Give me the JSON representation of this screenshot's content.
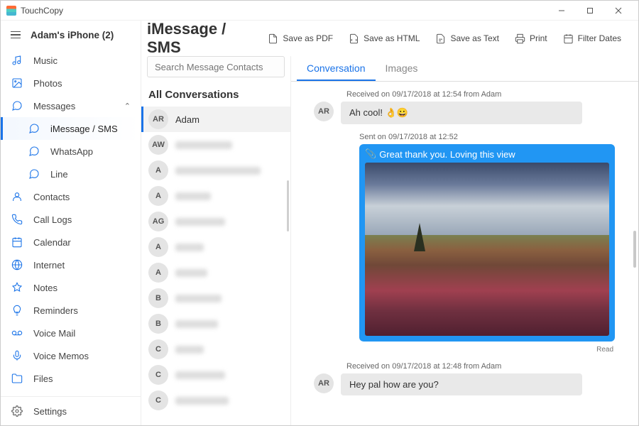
{
  "app": {
    "title": "TouchCopy"
  },
  "device": {
    "name": "Adam's iPhone (2)"
  },
  "nav": {
    "music": "Music",
    "photos": "Photos",
    "messages": "Messages",
    "imessage": "iMessage / SMS",
    "whatsapp": "WhatsApp",
    "line": "Line",
    "contacts": "Contacts",
    "calllogs": "Call Logs",
    "calendar": "Calendar",
    "internet": "Internet",
    "notes": "Notes",
    "reminders": "Reminders",
    "voicemail": "Voice Mail",
    "voicememos": "Voice Memos",
    "files": "Files",
    "settings": "Settings"
  },
  "page": {
    "title": "iMessage / SMS",
    "toolbar": {
      "pdf": "Save as PDF",
      "html": "Save as HTML",
      "text": "Save as Text",
      "print": "Print",
      "filter": "Filter Dates"
    },
    "search_placeholder": "Search Message Contacts",
    "all_conversations": "All Conversations",
    "tabs": {
      "conversation": "Conversation",
      "images": "Images"
    }
  },
  "contacts": [
    {
      "initials": "AR",
      "name": "Adam"
    },
    {
      "initials": "AW"
    },
    {
      "initials": "A"
    },
    {
      "initials": "A"
    },
    {
      "initials": "AG"
    },
    {
      "initials": "A"
    },
    {
      "initials": "A"
    },
    {
      "initials": "B"
    },
    {
      "initials": "B"
    },
    {
      "initials": "C"
    },
    {
      "initials": "C"
    },
    {
      "initials": "C"
    }
  ],
  "conversation": {
    "m1": {
      "meta": "Received on 09/17/2018 at 12:54 from Adam",
      "avatar": "AR",
      "text": "Ah cool! 👌😀"
    },
    "m2": {
      "meta": "Sent on 09/17/2018 at 12:52",
      "caption": "Great thank you. Loving this view",
      "read": "Read"
    },
    "m3": {
      "meta": "Received on 09/17/2018 at 12:48 from Adam",
      "avatar": "AR",
      "text": "Hey pal how are you?"
    }
  }
}
